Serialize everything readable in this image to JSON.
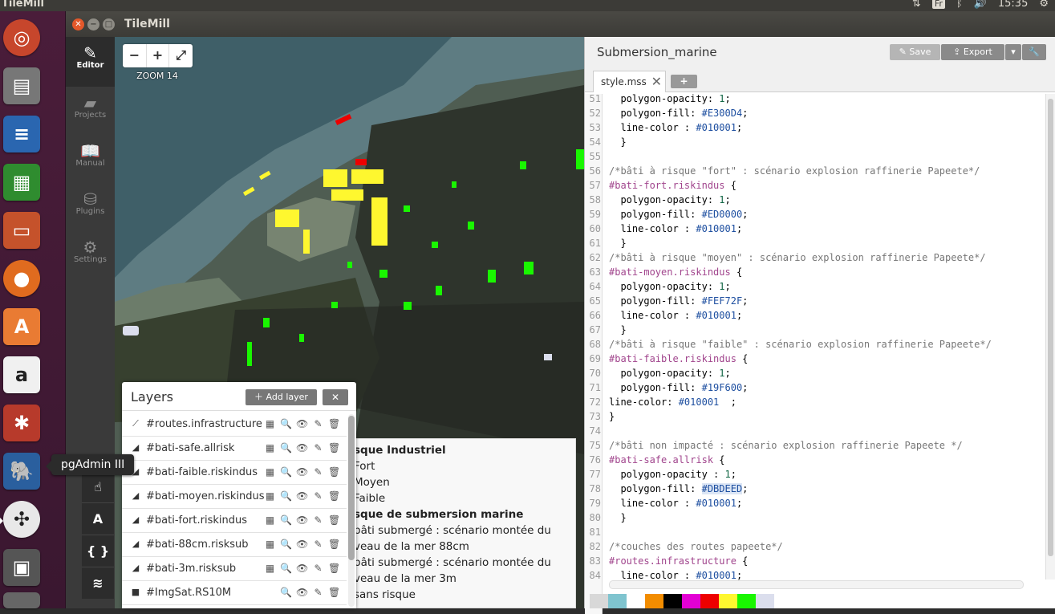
{
  "system_bar": {
    "app_name": "TileMill",
    "keyboard": "Fr",
    "clock": "15:35"
  },
  "launcher": {
    "tooltip": "pgAdmin III",
    "icons": [
      "ubuntu-dash-icon",
      "files-icon",
      "writer-icon",
      "calc-icon",
      "impress-icon",
      "firefox-icon",
      "software-center-icon",
      "amazon-icon",
      "system-settings-icon",
      "pgadmin-icon",
      "tilemill-icon",
      "save-disk-icon",
      "trash-icon"
    ]
  },
  "window": {
    "title": "TileMill"
  },
  "rail": {
    "editor": "Editor",
    "projects": "Projects",
    "manual": "Manual",
    "plugins": "Plugins",
    "settings": "Settings",
    "tool_font": "A",
    "tool_code": "{ }"
  },
  "map": {
    "zoom_label": "ZOOM 14",
    "zoom_in": "+",
    "zoom_out": "−"
  },
  "layers": {
    "title": "Layers",
    "add_label": "Add layer",
    "items": [
      {
        "name": "#routes.infrastructure",
        "type_icon": "line-icon"
      },
      {
        "name": "#bati-safe.allrisk",
        "type_icon": "polygon-icon"
      },
      {
        "name": "#bati-faible.riskindus",
        "type_icon": "polygon-icon"
      },
      {
        "name": "#bati-moyen.riskindus",
        "type_icon": "polygon-icon"
      },
      {
        "name": "#bati-fort.riskindus",
        "type_icon": "polygon-icon"
      },
      {
        "name": "#bati-88cm.risksub",
        "type_icon": "polygon-icon"
      },
      {
        "name": "#bati-3m.risksub",
        "type_icon": "polygon-icon"
      },
      {
        "name": "#ImgSat.RS10M",
        "type_icon": "raster-icon"
      }
    ]
  },
  "legend": {
    "rows": [
      {
        "text": "sque Industriel",
        "bold": true
      },
      {
        "text": "Fort",
        "bold": false
      },
      {
        "text": "Moyen",
        "bold": false
      },
      {
        "text": "Faible",
        "bold": false
      },
      {
        "text": "sque de submersion marine",
        "bold": true
      },
      {
        "text": "bâti submergé : scénario montée du",
        "bold": false
      },
      {
        "text": "veau de la mer 88cm",
        "bold": false
      },
      {
        "text": "bâti submergé : scénario montée du",
        "bold": false
      },
      {
        "text": "veau de la mer 3m",
        "bold": false
      },
      {
        "text": "sans risque",
        "bold": false
      }
    ]
  },
  "editor": {
    "project_title": "Submersion_marine",
    "save_label": "Save",
    "export_label": "Export",
    "tab_label": "style.mss",
    "tab_add": "+",
    "lines": [
      {
        "n": "51",
        "parts": [
          [
            "  polygon-opacity: ",
            ""
          ],
          [
            "1",
            "num"
          ],
          [
            ";",
            ""
          ]
        ]
      },
      {
        "n": "52",
        "parts": [
          [
            "  polygon-fill: ",
            ""
          ],
          [
            "#E300D4",
            "hex"
          ],
          [
            ";",
            ""
          ]
        ]
      },
      {
        "n": "53",
        "parts": [
          [
            "  line-color : ",
            ""
          ],
          [
            "#010001",
            "hex"
          ],
          [
            ";",
            ""
          ]
        ]
      },
      {
        "n": "54",
        "parts": [
          [
            "  }",
            ""
          ]
        ]
      },
      {
        "n": "55",
        "parts": [
          [
            "",
            ""
          ]
        ]
      },
      {
        "n": "56",
        "parts": [
          [
            "/*bâti à risque \"fort\" : scénario explosion raffinerie Papeete*/",
            "cmt"
          ]
        ]
      },
      {
        "n": "57",
        "parts": [
          [
            "#bati-fort.riskindus",
            "sel"
          ],
          [
            " {",
            ""
          ]
        ]
      },
      {
        "n": "58",
        "parts": [
          [
            "  polygon-opacity: ",
            ""
          ],
          [
            "1",
            "num"
          ],
          [
            ";",
            ""
          ]
        ]
      },
      {
        "n": "59",
        "parts": [
          [
            "  polygon-fill: ",
            ""
          ],
          [
            "#ED0000",
            "hex"
          ],
          [
            ";",
            ""
          ]
        ]
      },
      {
        "n": "60",
        "parts": [
          [
            "  line-color : ",
            ""
          ],
          [
            "#010001",
            "hex"
          ],
          [
            ";",
            ""
          ]
        ]
      },
      {
        "n": "61",
        "parts": [
          [
            "  }",
            ""
          ]
        ]
      },
      {
        "n": "62",
        "parts": [
          [
            "/*bâti à risque \"moyen\" : scénario explosion raffinerie Papeete*/",
            "cmt"
          ]
        ]
      },
      {
        "n": "63",
        "parts": [
          [
            "#bati-moyen.riskindus",
            "sel"
          ],
          [
            " {",
            ""
          ]
        ]
      },
      {
        "n": "64",
        "parts": [
          [
            "  polygon-opacity: ",
            ""
          ],
          [
            "1",
            "num"
          ],
          [
            ";",
            ""
          ]
        ]
      },
      {
        "n": "65",
        "parts": [
          [
            "  polygon-fill: ",
            ""
          ],
          [
            "#FEF72F",
            "hex"
          ],
          [
            ";",
            ""
          ]
        ]
      },
      {
        "n": "66",
        "parts": [
          [
            "  line-color : ",
            ""
          ],
          [
            "#010001",
            "hex"
          ],
          [
            ";",
            ""
          ]
        ]
      },
      {
        "n": "67",
        "parts": [
          [
            "  }",
            ""
          ]
        ]
      },
      {
        "n": "68",
        "parts": [
          [
            "/*bâti à risque \"faible\" : scénario explosion raffinerie Papeete*/",
            "cmt"
          ]
        ]
      },
      {
        "n": "69",
        "parts": [
          [
            "#bati-faible.riskindus",
            "sel"
          ],
          [
            " {",
            ""
          ]
        ]
      },
      {
        "n": "70",
        "parts": [
          [
            "  polygon-opacity: ",
            ""
          ],
          [
            "1",
            "num"
          ],
          [
            ";",
            ""
          ]
        ]
      },
      {
        "n": "71",
        "parts": [
          [
            "  polygon-fill: ",
            ""
          ],
          [
            "#19F600",
            "hex"
          ],
          [
            ";",
            ""
          ]
        ]
      },
      {
        "n": "72",
        "parts": [
          [
            "line-color: ",
            ""
          ],
          [
            "#010001",
            "hex"
          ],
          [
            "  ;",
            ""
          ]
        ]
      },
      {
        "n": "73",
        "parts": [
          [
            "}",
            ""
          ]
        ]
      },
      {
        "n": "74",
        "parts": [
          [
            "",
            ""
          ]
        ]
      },
      {
        "n": "75",
        "parts": [
          [
            "/*bâti non impacté : scénario explosion raffinerie Papeete */",
            "cmt"
          ]
        ]
      },
      {
        "n": "76",
        "parts": [
          [
            "#bati-safe.allrisk",
            "sel"
          ],
          [
            " {",
            ""
          ]
        ]
      },
      {
        "n": "77",
        "parts": [
          [
            "  polygon-opacity : ",
            ""
          ],
          [
            "1",
            "num"
          ],
          [
            ";",
            ""
          ]
        ]
      },
      {
        "n": "78",
        "parts": [
          [
            "  polygon-fill: ",
            ""
          ],
          [
            "#DBDEED",
            "hex hl"
          ],
          [
            ";",
            ""
          ]
        ]
      },
      {
        "n": "79",
        "parts": [
          [
            "  line-color : ",
            ""
          ],
          [
            "#010001",
            "hex"
          ],
          [
            ";",
            ""
          ]
        ]
      },
      {
        "n": "80",
        "parts": [
          [
            "  }",
            ""
          ]
        ]
      },
      {
        "n": "81",
        "parts": [
          [
            "",
            ""
          ]
        ]
      },
      {
        "n": "82",
        "parts": [
          [
            "/*couches des routes papeete*/",
            "cmt"
          ]
        ]
      },
      {
        "n": "83",
        "parts": [
          [
            "#routes.infrastructure",
            "sel"
          ],
          [
            " {",
            ""
          ]
        ]
      },
      {
        "n": "84",
        "parts": [
          [
            "  line-color : ",
            ""
          ],
          [
            "#010001",
            "hex"
          ],
          [
            ";",
            ""
          ]
        ]
      }
    ]
  },
  "palette": [
    "#D8D8D8",
    "#7FC4CF",
    "#FFFFFF",
    "#F28C00",
    "#000000",
    "#E300D4",
    "#ED0000",
    "#FEF72F",
    "#19F600",
    "#DBDEED"
  ],
  "colors": {
    "fort": "#ED0000",
    "moyen": "#FEF72F",
    "faible": "#19F600",
    "safe": "#DBDEED"
  }
}
